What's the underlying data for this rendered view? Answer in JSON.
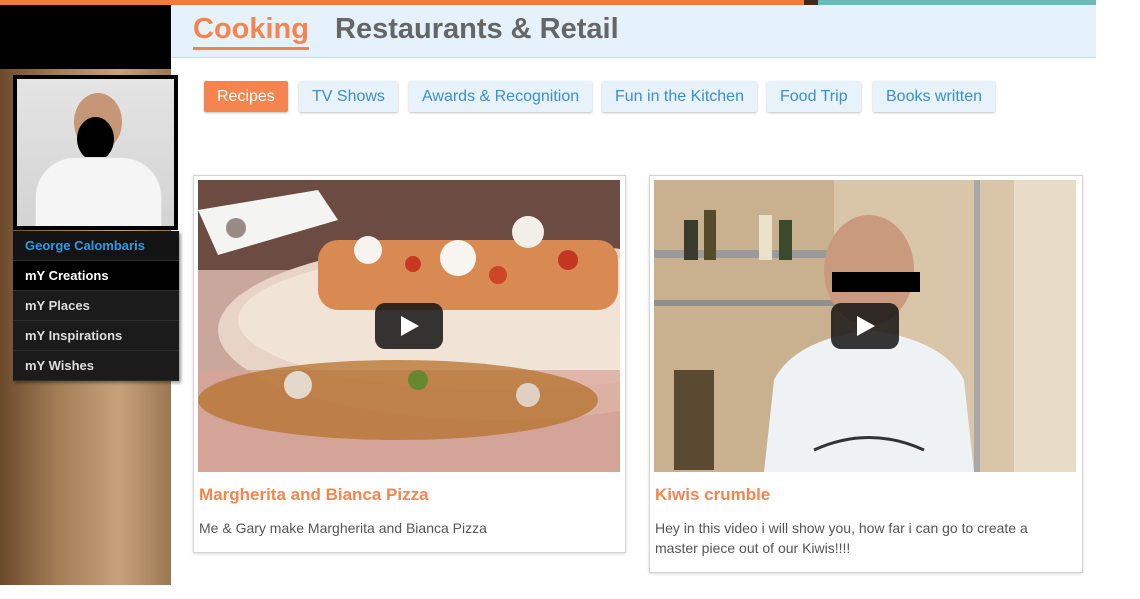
{
  "colors": {
    "accent": "#f5854e",
    "stripe_orange": "#f47a3c",
    "stripe_dark": "#3a2a20",
    "stripe_teal": "#6bbab7",
    "link_blue": "#3a8fcf",
    "name_blue": "#2a9be0"
  },
  "header": {
    "tabs": [
      {
        "label": "Cooking",
        "active": true
      },
      {
        "label": "Restaurants & Retail",
        "active": false
      }
    ]
  },
  "profile": {
    "photo_icon": "chef-portrait-icon"
  },
  "sidebar": {
    "items": [
      {
        "label": "George Calombaris"
      },
      {
        "label": "mY Creations"
      },
      {
        "label": "mY Places"
      },
      {
        "label": "mY Inspirations"
      },
      {
        "label": "mY Wishes"
      }
    ]
  },
  "subnav": {
    "items": [
      {
        "label": "Recipes",
        "active": true
      },
      {
        "label": "TV Shows"
      },
      {
        "label": "Awards & Recognition"
      },
      {
        "label": "Fun in the Kitchen"
      },
      {
        "label": "Food Trip"
      },
      {
        "label": "Books written"
      }
    ]
  },
  "videos": [
    {
      "title": "Margherita and Bianca Pizza",
      "description": "Me & Gary make Margherita and Bianca Pizza",
      "icon": "play-icon"
    },
    {
      "title": "Kiwis crumble",
      "description": "Hey in this video i will show you, how far i can go to create a master piece out of our Kiwis!!!!",
      "icon": "play-icon"
    }
  ]
}
